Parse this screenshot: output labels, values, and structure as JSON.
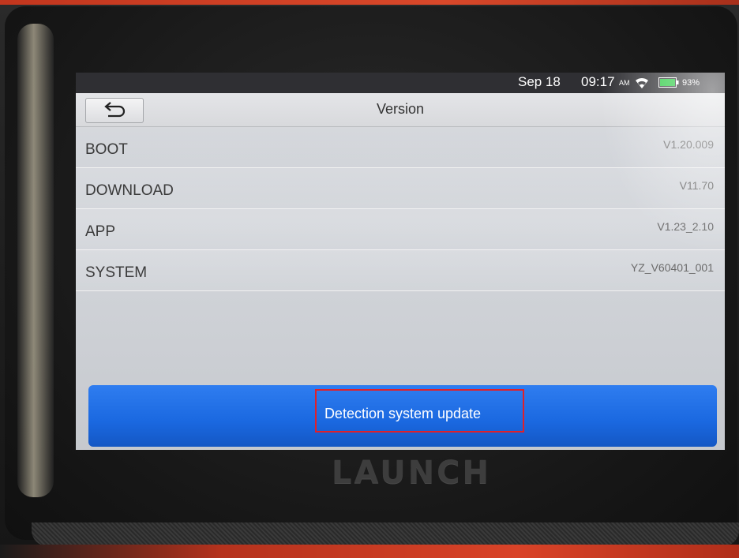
{
  "status_bar": {
    "date": "Sep 18",
    "time": "09:17",
    "ampm": "AM",
    "battery_percent": "93%",
    "icons": [
      "wifi-icon",
      "battery-icon"
    ],
    "battery_color": "#27c93f"
  },
  "header": {
    "title": "Version",
    "back_icon": "back-arrow-icon"
  },
  "versions": [
    {
      "label": "BOOT",
      "value": "V1.20.009"
    },
    {
      "label": "DOWNLOAD",
      "value": "V11.70"
    },
    {
      "label": "APP",
      "value": "V1.23_2.10"
    },
    {
      "label": "SYSTEM",
      "value": "YZ_V60401_001"
    }
  ],
  "actions": {
    "update_label": "Detection system update",
    "accent_color": "#1a68e0",
    "highlight_color": "#e0202a"
  },
  "device": {
    "brand": "LAUNCH"
  }
}
